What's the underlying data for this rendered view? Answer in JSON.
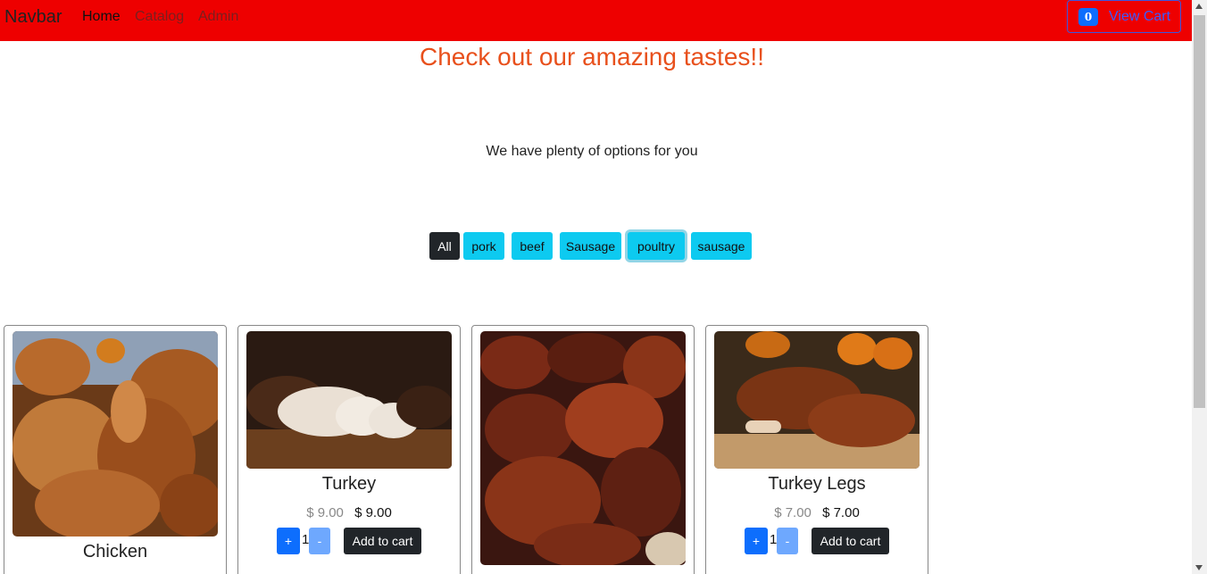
{
  "navbar": {
    "brand": "Navbar",
    "links": [
      "Home",
      "Catalog",
      "Admin"
    ],
    "cart": {
      "count": "0",
      "label": "View Cart"
    }
  },
  "hero": {
    "title": "Check out our amazing tastes!!",
    "subtitle": "We have plenty of options for you"
  },
  "filters": {
    "items": [
      "All",
      "pork",
      "beef",
      "Sausage",
      "poultry",
      "sausage"
    ],
    "active": "All",
    "focused": "poultry"
  },
  "products": [
    {
      "name": "Chicken"
    },
    {
      "name": "Turkey",
      "old_price": "$ 9.00",
      "price": "$ 9.00",
      "qty": "1",
      "plus": "+",
      "minus": "-",
      "add_label": "Add to cart"
    },
    {
      "name": ""
    },
    {
      "name": "Turkey Legs",
      "old_price": "$ 7.00",
      "price": "$ 7.00",
      "qty": "1",
      "plus": "+",
      "minus": "-",
      "add_label": "Add to cart"
    }
  ],
  "colors": {
    "navbar_bg": "#ee0000",
    "headline": "#e8501c",
    "filter_active": "#212529",
    "filter_pill": "#0dcaf0",
    "primary": "#0d6efd"
  }
}
